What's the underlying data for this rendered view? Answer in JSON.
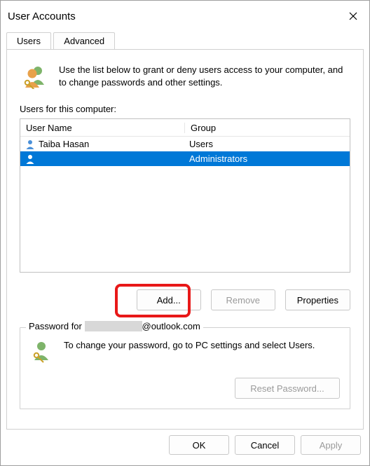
{
  "window": {
    "title": "User Accounts"
  },
  "tabs": {
    "users": "Users",
    "advanced": "Advanced"
  },
  "intro": {
    "text": "Use the list below to grant or deny users access to your computer, and to change passwords and other settings."
  },
  "list": {
    "label": "Users for this computer:",
    "columns": {
      "username": "User Name",
      "group": "Group"
    },
    "rows": [
      {
        "username": "Taiba Hasan",
        "group": "Users",
        "selected": false
      },
      {
        "username": "",
        "group": "Administrators",
        "selected": true
      }
    ]
  },
  "buttons": {
    "add": "Add...",
    "remove": "Remove",
    "properties": "Properties"
  },
  "password": {
    "legend_prefix": "Password for",
    "legend_suffix": "@outlook.com",
    "text": "To change your password, go to PC settings and select Users.",
    "reset": "Reset Password..."
  },
  "dialog": {
    "ok": "OK",
    "cancel": "Cancel",
    "apply": "Apply"
  }
}
